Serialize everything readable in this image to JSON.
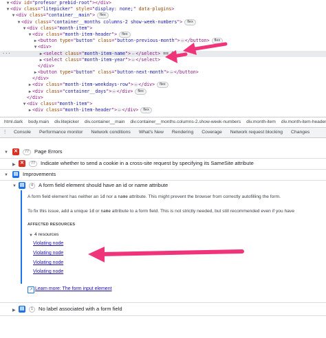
{
  "dom_tree": [
    {
      "indent": 1,
      "toggle": "▼",
      "parts": [
        [
          "tag",
          "<div "
        ],
        [
          "an",
          "id"
        ],
        [
          "tag",
          "=\""
        ],
        [
          "av",
          "profesor_prebid-root"
        ],
        [
          "tag",
          "\"></div>"
        ]
      ]
    },
    {
      "indent": 1,
      "toggle": "▼",
      "parts": [
        [
          "tag",
          "<div "
        ],
        [
          "an",
          "class"
        ],
        [
          "tag",
          "=\""
        ],
        [
          "av",
          "litepicker"
        ],
        [
          "tag",
          "\" "
        ],
        [
          "an",
          "style"
        ],
        [
          "tag",
          "=\""
        ],
        [
          "av",
          "display: none;"
        ],
        [
          "tag",
          "\" "
        ],
        [
          "an",
          "data-plugins"
        ],
        [
          "tag",
          ">"
        ]
      ]
    },
    {
      "indent": 2,
      "toggle": "▼",
      "badge": "flex",
      "parts": [
        [
          "tag",
          "<div "
        ],
        [
          "an",
          "class"
        ],
        [
          "tag",
          "=\""
        ],
        [
          "av",
          "container__main"
        ],
        [
          "tag",
          "\">"
        ]
      ]
    },
    {
      "indent": 3,
      "toggle": "▼",
      "badge": "flex",
      "parts": [
        [
          "tag",
          "<div "
        ],
        [
          "an",
          "class"
        ],
        [
          "tag",
          "=\""
        ],
        [
          "av",
          "container__months columns-2 show-week-numbers"
        ],
        [
          "tag",
          "\">"
        ]
      ]
    },
    {
      "indent": 4,
      "toggle": "▼",
      "parts": [
        [
          "tag",
          "<div "
        ],
        [
          "an",
          "class"
        ],
        [
          "tag",
          "=\""
        ],
        [
          "av",
          "month-item"
        ],
        [
          "tag",
          "\">"
        ]
      ]
    },
    {
      "indent": 5,
      "toggle": "▼",
      "badge": "flex",
      "parts": [
        [
          "tag",
          "<div "
        ],
        [
          "an",
          "class"
        ],
        [
          "tag",
          "=\""
        ],
        [
          "av",
          "month-item-header"
        ],
        [
          "tag",
          "\">"
        ]
      ]
    },
    {
      "indent": 6,
      "toggle": "▶",
      "ellipsis": true,
      "parts": [
        [
          "tag",
          "<button "
        ],
        [
          "an",
          "type"
        ],
        [
          "tag",
          "=\""
        ],
        [
          "av",
          "button"
        ],
        [
          "tag",
          "\" "
        ],
        [
          "an",
          "class"
        ],
        [
          "tag",
          "=\""
        ],
        [
          "av",
          "button-previous-month"
        ],
        [
          "tag",
          "\">"
        ]
      ],
      "after": [
        [
          "tag",
          "</button>"
        ]
      ],
      "badge_after": "flex"
    },
    {
      "indent": 6,
      "toggle": "▼",
      "parts": [
        [
          "tag",
          "<div>"
        ]
      ]
    },
    {
      "indent": 7,
      "toggle": "▶",
      "selected": true,
      "dots": true,
      "ellipsis": true,
      "parts": [
        [
          "tag",
          "<select "
        ],
        [
          "an",
          "class"
        ],
        [
          "tag",
          "=\""
        ],
        [
          "av",
          "month-item-name"
        ],
        [
          "tag",
          "\">"
        ]
      ],
      "after": [
        [
          "tag",
          "</select>"
        ],
        [
          "tx",
          " == $0"
        ]
      ]
    },
    {
      "indent": 7,
      "toggle": "▶",
      "ellipsis": true,
      "parts": [
        [
          "tag",
          "<select "
        ],
        [
          "an",
          "class"
        ],
        [
          "tag",
          "=\""
        ],
        [
          "av",
          "month-item-year"
        ],
        [
          "tag",
          "\">"
        ]
      ],
      "after": [
        [
          "tag",
          "</select>"
        ]
      ]
    },
    {
      "indent": 6,
      "toggle": "",
      "parts": [
        [
          "tag",
          "</div>"
        ]
      ]
    },
    {
      "indent": 6,
      "toggle": "▶",
      "ellipsis": true,
      "parts": [
        [
          "tag",
          "<button "
        ],
        [
          "an",
          "type"
        ],
        [
          "tag",
          "=\""
        ],
        [
          "av",
          "button"
        ],
        [
          "tag",
          "\" "
        ],
        [
          "an",
          "class"
        ],
        [
          "tag",
          "=\""
        ],
        [
          "av",
          "button-next-month"
        ],
        [
          "tag",
          "\">"
        ]
      ],
      "after": [
        [
          "tag",
          "</button>"
        ]
      ]
    },
    {
      "indent": 5,
      "toggle": "",
      "parts": [
        [
          "tag",
          "</div>"
        ]
      ]
    },
    {
      "indent": 5,
      "toggle": "▶",
      "ellipsis": true,
      "parts": [
        [
          "tag",
          "<div "
        ],
        [
          "an",
          "class"
        ],
        [
          "tag",
          "=\""
        ],
        [
          "av",
          "month-item-weekdays-row"
        ],
        [
          "tag",
          "\">"
        ]
      ],
      "after": [
        [
          "tag",
          "</div>"
        ]
      ],
      "badge_after": "flex"
    },
    {
      "indent": 5,
      "toggle": "▶",
      "ellipsis": true,
      "parts": [
        [
          "tag",
          "<div "
        ],
        [
          "an",
          "class"
        ],
        [
          "tag",
          "=\""
        ],
        [
          "av",
          "container__days"
        ],
        [
          "tag",
          "\">"
        ]
      ],
      "after": [
        [
          "tag",
          "</div>"
        ]
      ],
      "badge_after": "flex"
    },
    {
      "indent": 4,
      "toggle": "",
      "parts": [
        [
          "tag",
          "</div>"
        ]
      ]
    },
    {
      "indent": 4,
      "toggle": "▼",
      "parts": [
        [
          "tag",
          "<div "
        ],
        [
          "an",
          "class"
        ],
        [
          "tag",
          "=\""
        ],
        [
          "av",
          "month-item"
        ],
        [
          "tag",
          "\">"
        ]
      ]
    },
    {
      "indent": 5,
      "toggle": "▶",
      "ellipsis": true,
      "parts": [
        [
          "tag",
          "<div "
        ],
        [
          "an",
          "class"
        ],
        [
          "tag",
          "=\""
        ],
        [
          "av",
          "month-item-header"
        ],
        [
          "tag",
          "\">"
        ]
      ],
      "after": [
        [
          "tag",
          "</div>"
        ]
      ],
      "badge_after": "flex"
    }
  ],
  "breadcrumb": [
    "html.dark",
    "body.main",
    "div.litepicker",
    "div.container__main",
    "div.container__months.columns-2.show-week-numbers",
    "div.month-item",
    "div.month-item-header"
  ],
  "tabs": [
    "Console",
    "Performance monitor",
    "Network conditions",
    "What's New",
    "Rendering",
    "Coverage",
    "Network request blocking",
    "Changes"
  ],
  "issues": {
    "page_errors": {
      "count": "77",
      "label": "Page Errors"
    },
    "cookie_issue": {
      "count": "77",
      "label": "Indicate whether to send a cookie in a cross-site request by specifying its SameSite attribute"
    },
    "improvements": {
      "label": "Improvements"
    },
    "form_issue": {
      "count": "4",
      "label": "A form field element should have an id or name attribute",
      "desc1_pre": "A form field element has neither an ",
      "desc1_code1": "id",
      "desc1_mid": " nor a ",
      "desc1_code2": "name",
      "desc1_post": " attribute. This might prevent the browser from correctly autofilling the form.",
      "desc2_pre": "To fix this issue, add a unique ",
      "desc2_code1": "id",
      "desc2_mid": " or ",
      "desc2_code2": "name",
      "desc2_post": " attribute to a form field. This is not strictly needed, but still recommended even if you have",
      "affected_heading": "AFFECTED RESOURCES",
      "resources_toggle": "4 resources",
      "violating_nodes": [
        "Violating node",
        "Violating node",
        "Violating node",
        "Violating node"
      ],
      "learn_more": "Learn more: The form input element"
    },
    "label_issue": {
      "count": "1",
      "label": "No label associated with a form field"
    }
  },
  "colors": {
    "error": "#d93025",
    "info": "#1a73e8",
    "link": "#1a0dab",
    "arrow": "#f0347a"
  }
}
